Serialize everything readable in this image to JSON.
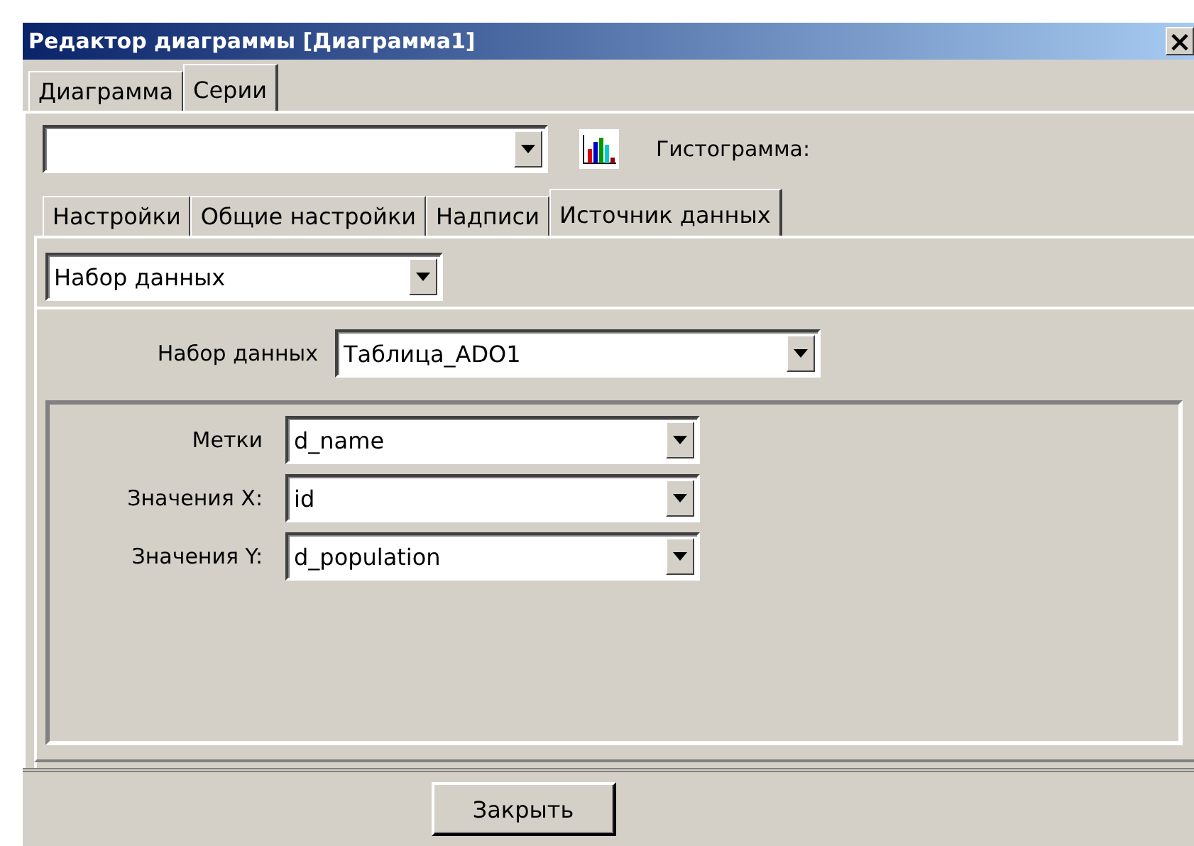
{
  "window": {
    "title": "Редактор диаграммы [Диаграмма1]",
    "close": "×"
  },
  "tabs": [
    {
      "label": "Диаграмма",
      "selected": false
    },
    {
      "label": "Серии",
      "selected": true
    }
  ],
  "series_type": "Гистограмма:",
  "inner_tabs": [
    {
      "label": "Настройки",
      "selected": false
    },
    {
      "label": "Общие настройки",
      "selected": false
    },
    {
      "label": "Надписи",
      "selected": false
    },
    {
      "label": "Источник данных",
      "selected": true
    }
  ],
  "source_kind": {
    "value": "Набор данных"
  },
  "dataset": {
    "label": "Набор данных",
    "value": "Таблица_ADO1"
  },
  "fields": [
    {
      "label": "Метки",
      "value": "d_name"
    },
    {
      "label": "Значения X:",
      "value": "id"
    },
    {
      "label": "Значения Y:",
      "value": "d_population"
    }
  ],
  "buttons": [
    "Закрыть"
  ]
}
